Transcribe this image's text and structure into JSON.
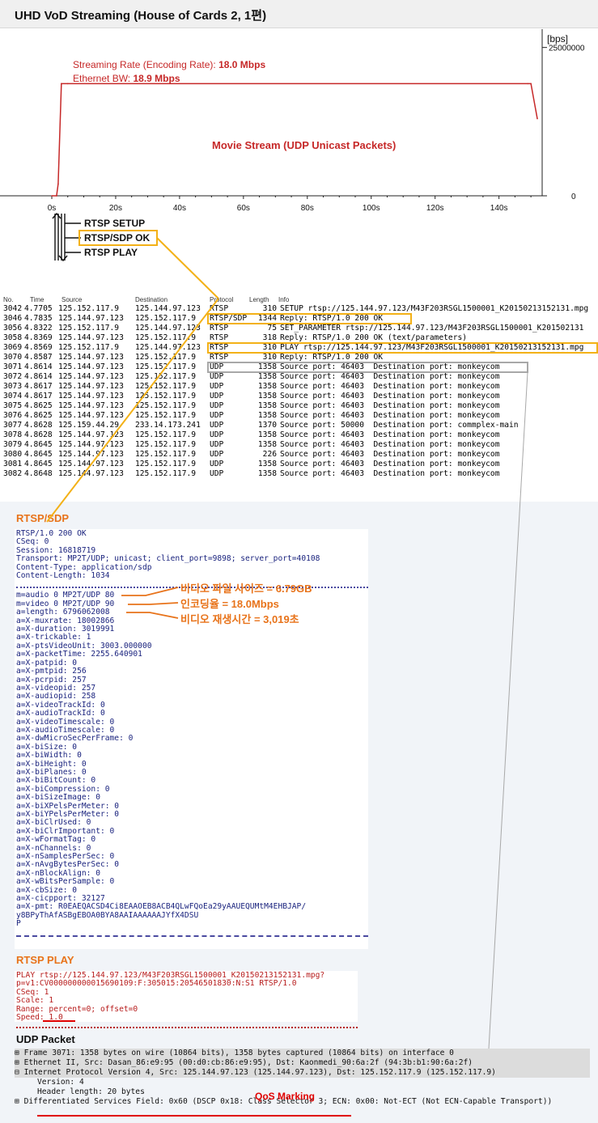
{
  "title": "UHD VoD Streaming (House of Cards 2, 1편)",
  "chart": {
    "unit_label": "[bps]",
    "y_tick_top": "25000000",
    "y_tick_zero": "0",
    "x_ticks": [
      "0s",
      "20s",
      "40s",
      "60s",
      "80s",
      "100s",
      "120s",
      "140s"
    ],
    "rate_label": "Streaming Rate (Encoding Rate): ",
    "rate_value": "18.0 Mbps",
    "eth_label": "Ethernet BW: ",
    "eth_value": "18.9 Mbps",
    "stream_label": "Movie Stream (UDP Unicast Packets)",
    "line_color": "#c62828"
  },
  "chart_data": {
    "type": "line",
    "series": [
      {
        "x": [
          0,
          1.5,
          2,
          3,
          5,
          149,
          150,
          152
        ],
        "y": [
          0,
          0,
          2000000,
          18900000,
          18900000,
          18900000,
          18900000,
          13000000
        ]
      }
    ],
    "xlim": [
      0,
      152
    ],
    "ylim": [
      0,
      27000000
    ],
    "y_ticks": [
      0,
      25000000
    ],
    "x_tick_values": [
      0,
      20,
      40,
      60,
      80,
      100,
      120,
      140
    ]
  },
  "sequence": {
    "setup": "RTSP SETUP",
    "sdp_ok": "RTSP/SDP OK",
    "play": "RTSP PLAY"
  },
  "packet_list": {
    "headers": {
      "no": "No.",
      "time": "Time",
      "source": "Source",
      "destination": "Destination",
      "protocol": "Protocol",
      "length": "Length",
      "info": "Info"
    },
    "rows": [
      {
        "no": "3042",
        "time": "4.7705",
        "src": "125.152.117.9",
        "dst": "125.144.97.123",
        "proto": "RTSP",
        "len": "310",
        "info": "SETUP rtsp://125.144.97.123/M43F203RSGL1500001_K20150213152131.mpg"
      },
      {
        "no": "3046",
        "time": "4.7835",
        "src": "125.144.97.123",
        "dst": "125.152.117.9",
        "proto": "RTSP/SDP",
        "len": "1344",
        "info": "Reply: RTSP/1.0 200 OK"
      },
      {
        "no": "3056",
        "time": "4.8322",
        "src": "125.152.117.9",
        "dst": "125.144.97.123",
        "proto": "RTSP",
        "len": "75",
        "info": "SET_PARAMETER rtsp://125.144.97.123/M43F203RSGL1500001_K201502131"
      },
      {
        "no": "3058",
        "time": "4.8369",
        "src": "125.144.97.123",
        "dst": "125.152.117.9",
        "proto": "RTSP",
        "len": "318",
        "info": "Reply: RTSP/1.0 200 OK (text/parameters)"
      },
      {
        "no": "3069",
        "time": "4.8569",
        "src": "125.152.117.9",
        "dst": "125.144.97.123",
        "proto": "RTSP",
        "len": "310",
        "info": "PLAY rtsp://125.144.97.123/M43F203RSGL1500001_K20150213152131.mpg"
      },
      {
        "no": "3070",
        "time": "4.8587",
        "src": "125.144.97.123",
        "dst": "125.152.117.9",
        "proto": "RTSP",
        "len": "310",
        "info": "Reply: RTSP/1.0 200 OK"
      },
      {
        "no": "3071",
        "time": "4.8614",
        "src": "125.144.97.123",
        "dst": "125.152.117.9",
        "proto": "UDP",
        "len": "1358",
        "info": "Source port: 46403  Destination port: monkeycom"
      },
      {
        "no": "3072",
        "time": "4.8614",
        "src": "125.144.97.123",
        "dst": "125.152.117.9",
        "proto": "UDP",
        "len": "1358",
        "info": "Source port: 46403  Destination port: monkeycom"
      },
      {
        "no": "3073",
        "time": "4.8617",
        "src": "125.144.97.123",
        "dst": "125.152.117.9",
        "proto": "UDP",
        "len": "1358",
        "info": "Source port: 46403  Destination port: monkeycom"
      },
      {
        "no": "3074",
        "time": "4.8617",
        "src": "125.144.97.123",
        "dst": "125.152.117.9",
        "proto": "UDP",
        "len": "1358",
        "info": "Source port: 46403  Destination port: monkeycom"
      },
      {
        "no": "3075",
        "time": "4.8625",
        "src": "125.144.97.123",
        "dst": "125.152.117.9",
        "proto": "UDP",
        "len": "1358",
        "info": "Source port: 46403  Destination port: monkeycom"
      },
      {
        "no": "3076",
        "time": "4.8625",
        "src": "125.144.97.123",
        "dst": "125.152.117.9",
        "proto": "UDP",
        "len": "1358",
        "info": "Source port: 46403  Destination port: monkeycom"
      },
      {
        "no": "3077",
        "time": "4.8628",
        "src": "125.159.44.29",
        "dst": "233.14.173.241",
        "proto": "UDP",
        "len": "1370",
        "info": "Source port: 50000  Destination port: commplex-main"
      },
      {
        "no": "3078",
        "time": "4.8628",
        "src": "125.144.97.123",
        "dst": "125.152.117.9",
        "proto": "UDP",
        "len": "1358",
        "info": "Source port: 46403  Destination port: monkeycom"
      },
      {
        "no": "3079",
        "time": "4.8645",
        "src": "125.144.97.123",
        "dst": "125.152.117.9",
        "proto": "UDP",
        "len": "1358",
        "info": "Source port: 46403  Destination port: monkeycom"
      },
      {
        "no": "3080",
        "time": "4.8645",
        "src": "125.144.97.123",
        "dst": "125.152.117.9",
        "proto": "UDP",
        "len": "226",
        "info": "Source port: 46403  Destination port: monkeycom"
      },
      {
        "no": "3081",
        "time": "4.8645",
        "src": "125.144.97.123",
        "dst": "125.152.117.9",
        "proto": "UDP",
        "len": "1358",
        "info": "Source port: 46403  Destination port: monkeycom"
      },
      {
        "no": "3082",
        "time": "4.8648",
        "src": "125.144.97.123",
        "dst": "125.152.117.9",
        "proto": "UDP",
        "len": "1358",
        "info": "Source port: 46403  Destination port: monkeycom"
      }
    ]
  },
  "rtsp_sdp": {
    "title": "RTSP/SDP",
    "header_lines": [
      "RTSP/1.0 200 OK",
      "CSeq: 0",
      "Session: 16818719",
      "Transport: MP2T/UDP; unicast; client_port=9898; server_port=40108",
      "Content-Type: application/sdp",
      "Content-Length: 1034"
    ],
    "body_lines": [
      "m=audio 0 MP2T/UDP 80",
      "m=video 0 MP2T/UDP 90",
      "a=length: 6796062008",
      "a=X-muxrate: 18002866",
      "a=X-duration: 3019991",
      "a=X-trickable: 1",
      "a=X-ptsVideoUnit: 3003.000000",
      "a=X-packetTime: 2255.640901",
      "a=X-patpid: 0",
      "a=X-pmtpid: 256",
      "a=X-pcrpid: 257",
      "a=X-videopid: 257",
      "a=X-audiopid: 258",
      "a=X-videoTrackId: 0",
      "a=X-audioTrackId: 0",
      "a=X-videoTimescale: 0",
      "a=X-audioTimescale: 0",
      "a=X-dwMicroSecPerFrame: 0",
      "a=X-biSize: 0",
      "a=X-biWidth: 0",
      "a=X-biHeight: 0",
      "a=X-biPlanes: 0",
      "a=X-biBitCount: 0",
      "a=X-biCompression: 0",
      "a=X-biSizeImage: 0",
      "a=X-biXPelsPerMeter: 0",
      "a=X-biYPelsPerMeter: 0",
      "a=X-biClrUsed: 0",
      "a=X-biClrImportant: 0",
      "a=X-wFormatTag: 0",
      "a=X-nChannels: 0",
      "a=X-nSamplesPerSec: 0",
      "a=X-nAvgBytesPerSec: 0",
      "a=X-nBlockAlign: 0",
      "a=X-wBitsPerSample: 0",
      "a=X-cbSize: 0",
      "a=X-cicpport: 32127",
      "a=X-pmt: R0EAEQACSD4Ci8EAAOEB8ACB4QLwFQoEa29yAAUEQUMtM4EHBJAP/",
      "y8BPyThAfASBgEBOA0BYA8AAIAAAAAAJYfX4DSU",
      "P"
    ],
    "annotations": {
      "size": "비디오 파일 사이즈 = 6.79GB",
      "rate": "인코딩율 = 18.0Mbps",
      "duration": "비디오 재생시간 = 3,019초"
    }
  },
  "rtsp_play": {
    "title": "RTSP PLAY",
    "lines": [
      "PLAY rtsp://125.144.97.123/M43F203RSGL1500001_K20150213152131.mpg?",
      "p=v1:CV000000000015690109:F:305015:20546501830:N:S1 RTSP/1.0",
      "CSeq: 1",
      "Scale: 1",
      "Range: percent=0; offset=0",
      "Speed: 1.0"
    ]
  },
  "udp_packet": {
    "title": "UDP Packet",
    "lines": [
      "Frame 3071: 1358 bytes on wire (10864 bits), 1358 bytes captured (10864 bits) on interface 0",
      "Ethernet II, Src: Dasan_86:e9:95 (00:d0:cb:86:e9:95), Dst: Kaonmedi_90:6a:2f (94:3b:b1:90:6a:2f)",
      "Internet Protocol Version 4, Src: 125.144.97.123 (125.144.97.123), Dst: 125.152.117.9 (125.152.117.9)",
      "Version: 4",
      "Header length: 20 bytes",
      "Differentiated Services Field: 0x60 (DSCP 0x18: Class Selector 3; ECN: 0x00: Not-ECT (Not ECN-Capable Transport))"
    ],
    "qos_label": "QoS Marking"
  },
  "colors": {
    "highlight": "#f3b117",
    "accent_red": "#c62828",
    "anno_orange": "#e8731a",
    "sdp_text": "#1a237e",
    "play_text": "#b71c1c"
  }
}
